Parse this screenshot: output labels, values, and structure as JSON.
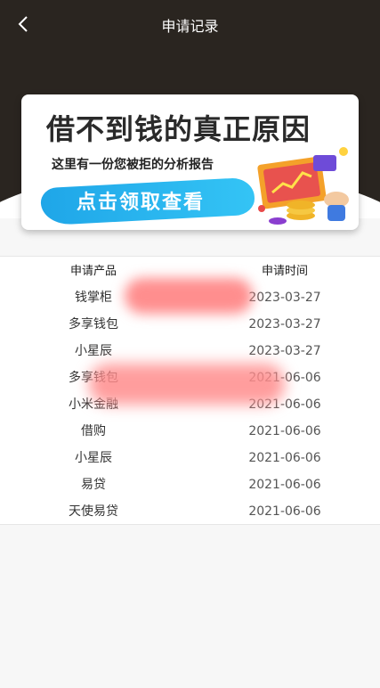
{
  "header": {
    "title": "申请记录"
  },
  "banner": {
    "headline": "借不到钱的真正原因",
    "subline": "这里有一份您被拒的分析报告",
    "cta_label": "点击领取查看"
  },
  "table": {
    "columns": [
      "申请产品",
      "申请时间"
    ],
    "rows": [
      {
        "name": "钱掌柜",
        "date": "2023-03-27"
      },
      {
        "name": "多享钱包",
        "date": "2023-03-27"
      },
      {
        "name": "小星辰",
        "date": "2023-03-27"
      },
      {
        "name": "多享钱包",
        "date": "2021-06-06"
      },
      {
        "name": "小米金融",
        "date": "2021-06-06"
      },
      {
        "name": "借购",
        "date": "2021-06-06"
      },
      {
        "name": "小星辰",
        "date": "2021-06-06"
      },
      {
        "name": "易贷",
        "date": "2021-06-06"
      },
      {
        "name": "天使易贷",
        "date": "2021-06-06"
      }
    ]
  },
  "colors": {
    "topbar": "#2a2520",
    "cta": "#1fa6e8",
    "blur": "#ff8282"
  }
}
